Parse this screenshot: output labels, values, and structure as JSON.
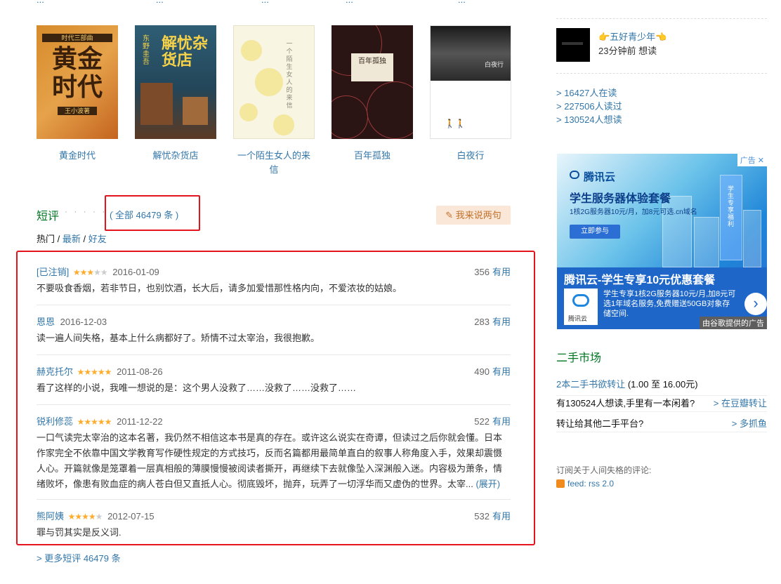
{
  "top_strip": [
    "...",
    "...",
    "...",
    "...",
    "..."
  ],
  "books": [
    {
      "title": "黄金时代",
      "cover_text": "黄金时代",
      "cover_top": "时代三部曲",
      "cover_author": "王小波著"
    },
    {
      "title": "解忧杂货店",
      "cover_text": "解忧杂货店",
      "cover_author": "东野圭吾"
    },
    {
      "title": "一个陌生女人的来信",
      "cover_text": "一个陌生女人的来信"
    },
    {
      "title": "百年孤独",
      "cover_text": "百年孤独"
    },
    {
      "title": "白夜行",
      "cover_text": "白夜行"
    }
  ],
  "short_reviews": {
    "title": "短评",
    "dots": "· · · · · ·",
    "all_count": "( 全部 46479 条 )",
    "write_button": "我来说两句",
    "filters": {
      "hot": "热门",
      "sep1": " / ",
      "latest": "最新",
      "sep2": " / ",
      "friends": "好友"
    },
    "comments": [
      {
        "user": "[已注销]",
        "stars": "★★★",
        "stars_off": "★★",
        "date": "2016-01-09",
        "votes": "356",
        "useful": "有用",
        "text": "不要吸食香烟，若非节日，也别饮酒，长大后，请多加爱惜那性格内向，不爱浓妆的姑娘。"
      },
      {
        "user": "恩恩",
        "stars": "",
        "stars_off": "",
        "date": "2016-12-03",
        "votes": "283",
        "useful": "有用",
        "text": "读一遍人间失格，基本上什么病都好了。矫情不过太宰治，我很抱歉。"
      },
      {
        "user": "赫克托尔",
        "stars": "★★★★★",
        "stars_off": "",
        "date": "2011-08-26",
        "votes": "490",
        "useful": "有用",
        "text": "看了这样的小说，我唯一想说的是：这个男人没救了……没救了……没救了……"
      },
      {
        "user": "锐利修蕊",
        "stars": "★★★★★",
        "stars_off": "",
        "date": "2011-12-22",
        "votes": "522",
        "useful": "有用",
        "text": "一口气读完太宰治的这本名著，我仍然不相信这本书是真的存在。或许这么说实在奇谭，但读过之后你就会懂。日本作家完全不依靠中国文学教育写作硬性规定的方式技巧，反而名篇都用最简单直白的叙事人称角度入手，效果却震慑人心。开篇就像是笼罩着一层真相般的薄膜慢慢被阅读者撕开，再继续下去就像坠入深渊般入迷。内容极为萧条，情绪败坏，像患有败血症的病人苍白但又直抵人心。彻底毁坏，抛弃，玩弄了一切浮华而又虚伪的世界。太宰...",
        "expand": "(展开)"
      },
      {
        "user": "熊阿姨",
        "stars": "★★★★",
        "stars_off": "★",
        "date": "2012-07-15",
        "votes": "532",
        "useful": "有用",
        "text": "罪与罚其实是反义词."
      }
    ],
    "more_link": "> 更多短评 46479 条"
  },
  "sidebar": {
    "user": {
      "name": "👉五好青少年👈",
      "time": "23分钟前 想读"
    },
    "stats": [
      "> 16427人在读",
      "> 227506人读过",
      "> 130524人想读"
    ],
    "ad": {
      "tag": "广告",
      "brand": "腾讯云",
      "headline": "学生服务器体验套餐",
      "sub": "1核2G服务器10元/月，加8元可选.cn域名",
      "join": "立即参与",
      "title2": "腾讯云-学生专享10元优惠套餐",
      "logo_text": "腾讯云",
      "desc": "学生专享1核2G服务器10元/月,加8元可选1年域名服务,免费赠送50GB对象存储空间.",
      "from": "由谷歌提供的广告",
      "tower_text": "学生专享福利",
      "arrow": "›"
    },
    "used_market": {
      "title": "二手市场",
      "line1_link": "2本二手书欲转让",
      "line1_rest": " (1.00 至 16.00元)",
      "row1_text": "有130524人想读,手里有一本闲着?",
      "row1_link": "> 在豆瓣转让",
      "row2_text": "转让给其他二手平台?",
      "row2_link": "> 多抓鱼"
    },
    "subscribe": "订阅关于人间失格的评论:",
    "feed": "feed: rss 2.0"
  }
}
